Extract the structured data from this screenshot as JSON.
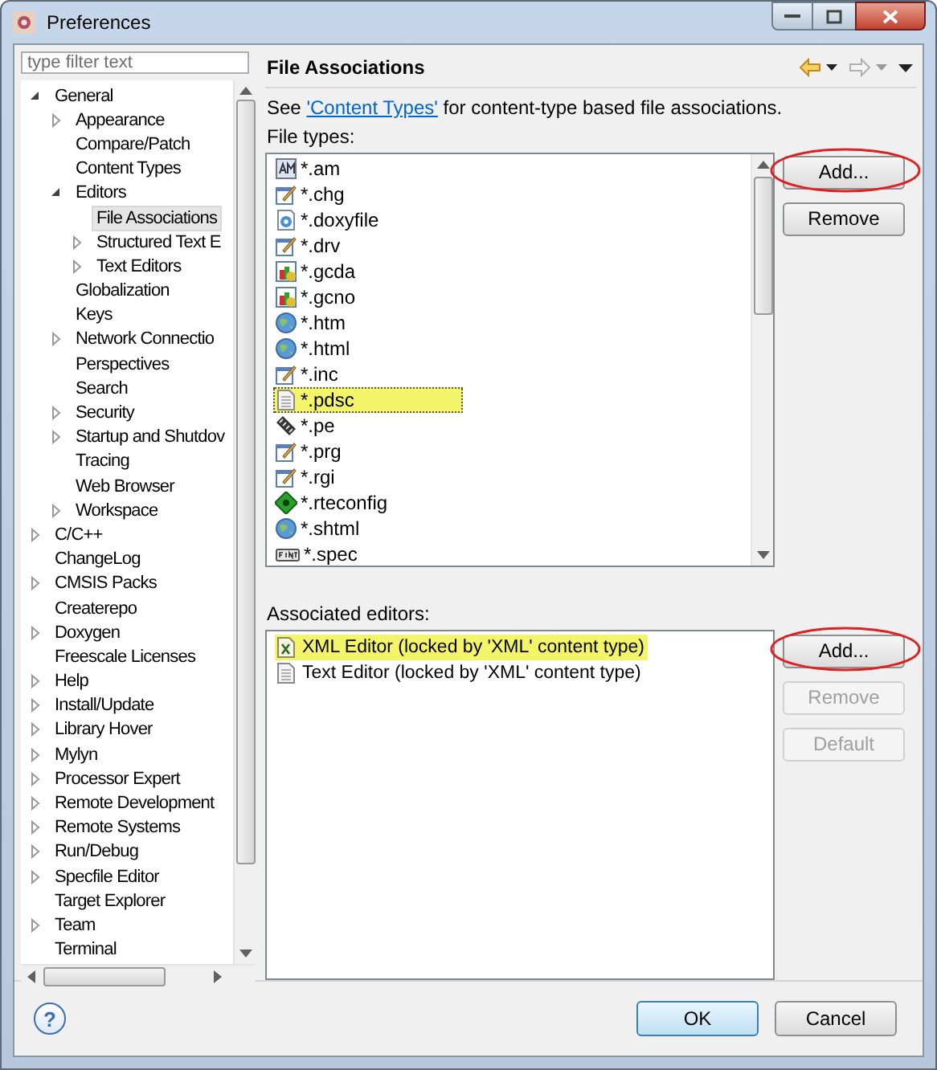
{
  "window": {
    "title": "Preferences"
  },
  "filter": {
    "placeholder": "type filter text"
  },
  "tree": [
    {
      "label": "General",
      "expanded": true,
      "selected": false,
      "children": [
        {
          "label": "Appearance",
          "expanded": false,
          "selected": false
        },
        {
          "label": "Compare/Patch",
          "selected": false
        },
        {
          "label": "Content Types",
          "selected": false
        },
        {
          "label": "Editors",
          "expanded": true,
          "selected": false,
          "children": [
            {
              "label": "File Associations",
              "selected": true
            },
            {
              "label": "Structured Text E",
              "expanded": false,
              "selected": false
            },
            {
              "label": "Text Editors",
              "expanded": false,
              "selected": false
            }
          ]
        },
        {
          "label": "Globalization",
          "selected": false
        },
        {
          "label": "Keys",
          "selected": false
        },
        {
          "label": "Network Connectio",
          "expanded": false,
          "selected": false
        },
        {
          "label": "Perspectives",
          "selected": false
        },
        {
          "label": "Search",
          "selected": false
        },
        {
          "label": "Security",
          "expanded": false,
          "selected": false
        },
        {
          "label": "Startup and Shutdov",
          "expanded": false,
          "selected": false
        },
        {
          "label": "Tracing",
          "selected": false
        },
        {
          "label": "Web Browser",
          "selected": false
        },
        {
          "label": "Workspace",
          "expanded": false,
          "selected": false
        }
      ]
    },
    {
      "label": "C/C++",
      "expanded": false,
      "selected": false
    },
    {
      "label": "ChangeLog",
      "selected": false
    },
    {
      "label": "CMSIS Packs",
      "expanded": false,
      "selected": false
    },
    {
      "label": "Createrepo",
      "selected": false
    },
    {
      "label": "Doxygen",
      "expanded": false,
      "selected": false
    },
    {
      "label": "Freescale Licenses",
      "selected": false
    },
    {
      "label": "Help",
      "expanded": false,
      "selected": false
    },
    {
      "label": "Install/Update",
      "expanded": false,
      "selected": false
    },
    {
      "label": "Library Hover",
      "expanded": false,
      "selected": false
    },
    {
      "label": "Mylyn",
      "expanded": false,
      "selected": false
    },
    {
      "label": "Processor Expert",
      "expanded": false,
      "selected": false
    },
    {
      "label": "Remote Development",
      "expanded": false,
      "selected": false
    },
    {
      "label": "Remote Systems",
      "expanded": false,
      "selected": false
    },
    {
      "label": "Run/Debug",
      "expanded": false,
      "selected": false
    },
    {
      "label": "Specfile Editor",
      "expanded": false,
      "selected": false
    },
    {
      "label": "Target Explorer",
      "selected": false
    },
    {
      "label": "Team",
      "expanded": false,
      "selected": false
    },
    {
      "label": "Terminal",
      "selected": false
    }
  ],
  "page": {
    "title": "File Associations",
    "intro": {
      "before": "See",
      "link": "'Content Types'",
      "after": "for content-type based file associations."
    },
    "file_types": {
      "label": "File types:",
      "rows": [
        {
          "name": "*.am",
          "kind": "am",
          "selected": false,
          "highlighted": false
        },
        {
          "name": "*.chg",
          "kind": "edit",
          "selected": false,
          "highlighted": false
        },
        {
          "name": "*.doxyfile",
          "kind": "doxy",
          "selected": false,
          "highlighted": false
        },
        {
          "name": "*.drv",
          "kind": "edit",
          "selected": false,
          "highlighted": false
        },
        {
          "name": "*.gcda",
          "kind": "gcov",
          "selected": false,
          "highlighted": false
        },
        {
          "name": "*.gcno",
          "kind": "gcov",
          "selected": false,
          "highlighted": false
        },
        {
          "name": "*.htm",
          "kind": "globe",
          "selected": false,
          "highlighted": false
        },
        {
          "name": "*.html",
          "kind": "globe",
          "selected": false,
          "highlighted": false
        },
        {
          "name": "*.inc",
          "kind": "edit",
          "selected": false,
          "highlighted": false
        },
        {
          "name": "*.pdsc",
          "kind": "text",
          "selected": true,
          "highlighted": true
        },
        {
          "name": "*.pe",
          "kind": "pe",
          "selected": false,
          "highlighted": false
        },
        {
          "name": "*.prg",
          "kind": "edit",
          "selected": false,
          "highlighted": false
        },
        {
          "name": "*.rgi",
          "kind": "edit",
          "selected": false,
          "highlighted": false
        },
        {
          "name": "*.rteconfig",
          "kind": "rte",
          "selected": false,
          "highlighted": false
        },
        {
          "name": "*.shtml",
          "kind": "globe",
          "selected": false,
          "highlighted": false
        },
        {
          "name": "*.spec",
          "kind": "spec",
          "selected": false,
          "highlighted": false
        }
      ],
      "buttons": [
        {
          "label": "Add...",
          "disabled": false,
          "circled": true
        },
        {
          "label": "Remove",
          "disabled": false,
          "circled": false
        }
      ]
    },
    "editors": {
      "label": "Associated editors:",
      "rows": [
        {
          "name": "XML Editor (locked by 'XML' content type)",
          "kind": "xml",
          "highlighted": true
        },
        {
          "name": "Text Editor (locked by 'XML' content type)",
          "kind": "text",
          "highlighted": false
        }
      ],
      "buttons": [
        {
          "label": "Add...",
          "disabled": false,
          "circled": true
        },
        {
          "label": "Remove",
          "disabled": true,
          "circled": false
        },
        {
          "label": "Default",
          "disabled": true,
          "circled": false
        }
      ]
    }
  },
  "footer": {
    "help": "?",
    "buttons": [
      {
        "label": "OK",
        "default": true
      },
      {
        "label": "Cancel",
        "default": false
      }
    ]
  }
}
